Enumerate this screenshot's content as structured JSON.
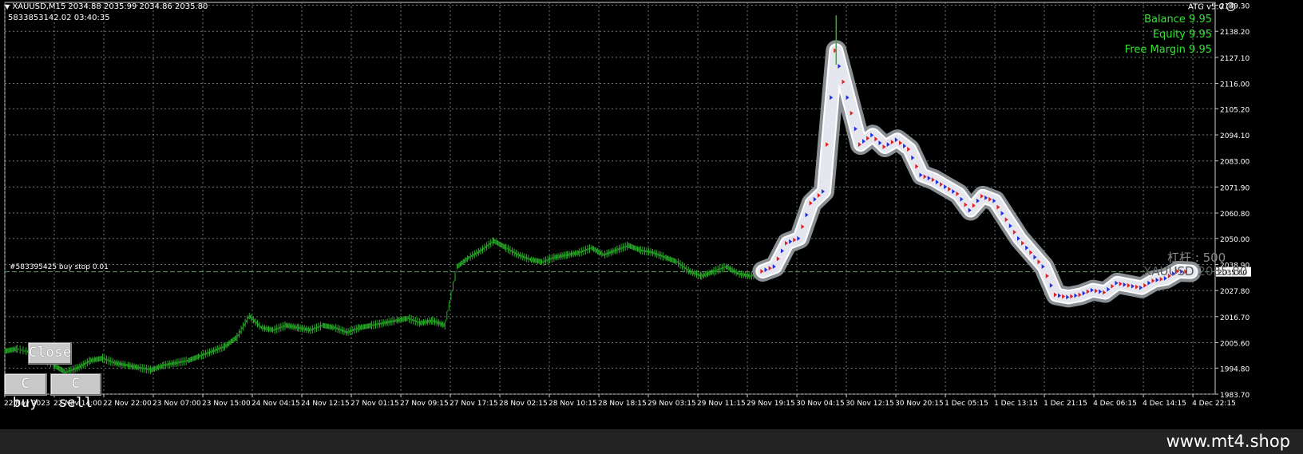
{
  "header": {
    "symbol_line": "XAUUSD,M15  2034.88 2035.99 2034.86 2035.80",
    "account_line": "5833853142.02     03:40:35",
    "ea_label": "ATG v5.0"
  },
  "account_panel": {
    "balance": "Balance 9.95",
    "equity": "Equity 9.95",
    "free_margin": "Free Margin 9.95"
  },
  "order_line": {
    "label": "#583395425 buy stop 0.01",
    "price": 2035.8
  },
  "overlay_text": {
    "leverage": "杠杆 : 500",
    "symbol_price": "XAUUSD 2035.80"
  },
  "buttons": {
    "close": "Close",
    "c_buy": "C buy",
    "c_sell": "C sell"
  },
  "footer": {
    "site": "www.mt4.shop"
  },
  "colors": {
    "background": "#000000",
    "grid": "#6f7a6f",
    "candles": "#28b428",
    "text": "#ffffff",
    "account_green": "#2ee62e",
    "current_price_tag": "#ffffff"
  },
  "chart_data": {
    "type": "line",
    "title": "",
    "xlabel": "",
    "ylabel": "",
    "ylim": [
      1983.7,
      2150.5
    ],
    "y_ticks": [
      "2149.30",
      "2138.20",
      "2127.10",
      "2116.00",
      "2105.20",
      "2094.10",
      "2083.00",
      "2071.90",
      "2060.80",
      "2050.00",
      "2038.90",
      "2027.80",
      "2016.70",
      "2005.60",
      "1994.80",
      "1983.70"
    ],
    "x_ticks": [
      "22 Nov 2023",
      "22 Nov 14:00",
      "22 Nov 22:00",
      "23 Nov 07:00",
      "23 Nov 15:00",
      "24 Nov 04:15",
      "24 Nov 12:15",
      "27 Nov 01:15",
      "27 Nov 09:15",
      "27 Nov 17:15",
      "28 Nov 02:15",
      "28 Nov 10:15",
      "28 Nov 18:15",
      "29 Nov 03:15",
      "29 Nov 11:15",
      "29 Nov 19:15",
      "30 Nov 04:15",
      "30 Nov 12:15",
      "30 Nov 20:15",
      "1 Dec 05:15",
      "1 Dec 13:15",
      "1 Dec 21:15",
      "4 Dec 06:15",
      "4 Dec 14:15",
      "4 Dec 22:15"
    ],
    "current_price": 2035.8,
    "series": [
      {
        "x": [
          0,
          2,
          5,
          8,
          10,
          12,
          14,
          16,
          18,
          20,
          22,
          24,
          26,
          28,
          30,
          32,
          34,
          36,
          38,
          40,
          42,
          44,
          46,
          48,
          50,
          52,
          54,
          56,
          58,
          60,
          62,
          64,
          66,
          68,
          70,
          72,
          74,
          76,
          78,
          80,
          82,
          84,
          86,
          88,
          90,
          92,
          94,
          96,
          98,
          100,
          102,
          104,
          106,
          108,
          110,
          112,
          114,
          116,
          118,
          120,
          122,
          124
        ],
        "y": [
          2002,
          2003,
          2001,
          1996,
          1993,
          1995,
          1998,
          1999,
          1997,
          1996,
          1995,
          1994,
          1996,
          1997,
          1998,
          2000,
          2002,
          2004,
          2008,
          2017,
          2012,
          2011,
          2013,
          2012,
          2011,
          2013,
          2012,
          2010,
          2012,
          2013,
          2014,
          2015,
          2016,
          2014,
          2015,
          2013,
          2038,
          2042,
          2045,
          2049,
          2046,
          2043,
          2041,
          2040,
          2042,
          2043,
          2044,
          2046,
          2043,
          2045,
          2047,
          2045,
          2044,
          2042,
          2040,
          2036,
          2034,
          2036,
          2038,
          2035,
          2034,
          2036
        ]
      },
      {
        "x": [
          124,
          126,
          128,
          130,
          132,
          134,
          136,
          138,
          140,
          142,
          144,
          146,
          148,
          150,
          152,
          154,
          156,
          158,
          160,
          162,
          164,
          166,
          168,
          170,
          172,
          174,
          176,
          178,
          180,
          182,
          184,
          186,
          188,
          190,
          192,
          194
        ],
        "y": [
          2036,
          2038,
          2048,
          2050,
          2065,
          2070,
          2130,
          2110,
          2090,
          2094,
          2089,
          2092,
          2088,
          2077,
          2075,
          2072,
          2069,
          2062,
          2068,
          2066,
          2058,
          2050,
          2044,
          2038,
          2026,
          2025,
          2026,
          2028,
          2027,
          2031,
          2030,
          2029,
          2032,
          2033,
          2036,
          2035.8
        ]
      }
    ]
  }
}
